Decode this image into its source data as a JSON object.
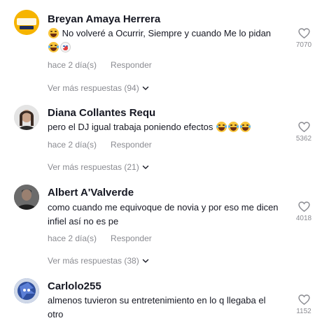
{
  "comments": [
    {
      "author": "Breyan Amaya Herrera",
      "avatar_label": "Cojuas",
      "text": "No volveré a Ocurrir, Siempre y cuando Me lo pidan",
      "time": "hace 2 día(s)",
      "reply": "Responder",
      "likes": "7070",
      "more_replies": "Ver más respuestas (94)"
    },
    {
      "author": "Diana Collantes Requ",
      "text": "pero el DJ igual trabaja poniendo efectos",
      "time": "hace 2 día(s)",
      "reply": "Responder",
      "likes": "5362",
      "more_replies": "Ver más respuestas (21)"
    },
    {
      "author": "Albert A'Valverde",
      "text": "como cuando me equivoque de novia y por eso me dicen infiel así no es pe",
      "time": "hace 2 día(s)",
      "reply": "Responder",
      "likes": "4018",
      "more_replies": "Ver más respuestas (38)"
    },
    {
      "author": "Carlolo255",
      "text": "almenos tuvieron su entretenimiento en lo q llegaba el otro",
      "likes": "1152"
    }
  ],
  "icons": {
    "like": "heart-outline-icon",
    "expand": "chevron-down-icon",
    "emoji_laugh": "face-with-tears-of-joy-emoji",
    "emoji_grin": "grinning-squinting-emoji",
    "emoji_clown": "clown-face-emoji"
  },
  "colors": {
    "text": "#161823",
    "secondary": "#8a8b91",
    "emoji_yellow": "#f8c43a"
  }
}
